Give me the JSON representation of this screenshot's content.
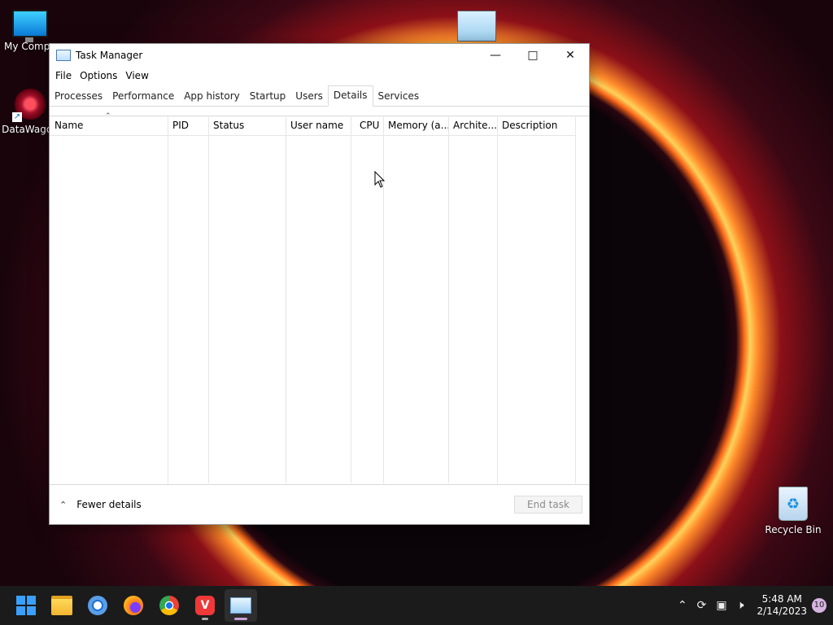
{
  "desktop": {
    "icons": [
      {
        "label": "My Compu"
      },
      {
        "label": "DataWagon"
      },
      {
        "label": "Recycle Bin"
      }
    ]
  },
  "window": {
    "title": "Task Manager",
    "menu": [
      "File",
      "Options",
      "View"
    ],
    "tabs": [
      "Processes",
      "Performance",
      "App history",
      "Startup",
      "Users",
      "Details",
      "Services"
    ],
    "active_tab": "Details",
    "columns": [
      "Name",
      "PID",
      "Status",
      "User name",
      "CPU",
      "Memory (a...",
      "Archite...",
      "Description"
    ],
    "footer": {
      "fewer_details": "Fewer details",
      "end_task": "End task"
    }
  },
  "taskbar": {
    "apps": [
      "start-icon",
      "file-explorer-icon",
      "chromium-icon",
      "firefox-icon",
      "chrome-icon",
      "vivaldi-icon",
      "task-manager-icon"
    ],
    "clock_time": "5:48 AM",
    "clock_date": "2/14/2023",
    "notification_count": "10"
  },
  "colors": {
    "accent": "#3aa0ff",
    "taskbar": "#1b1b1b"
  }
}
